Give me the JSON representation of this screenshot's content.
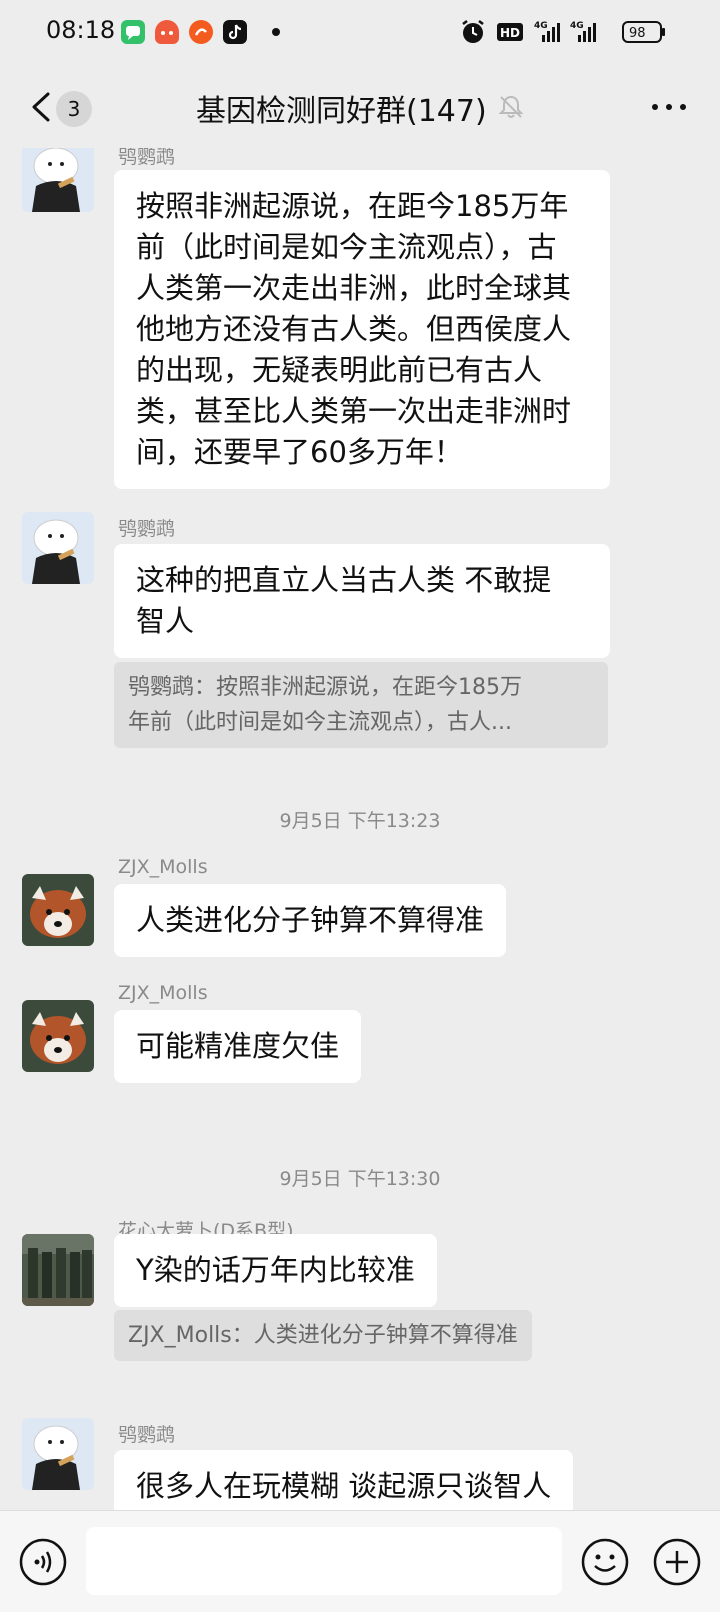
{
  "status_bar": {
    "time": "08:18",
    "hd_label": "HD",
    "net_label_1": "4G",
    "net_label_2": "4G",
    "battery": "98"
  },
  "header": {
    "back_badge": "3",
    "title": "基因检测同好群(147)"
  },
  "messages": [
    {
      "sender": "鸮鹦鹉",
      "lines": [
        "按照非洲起源说，在距今185万年",
        "前（此时间是如今主流观点），古",
        "人类第一次走出非洲，此时全球其",
        "他地方还没有古人类。但西侯度人",
        "的出现，无疑表明此前已有古人",
        "类，甚至比人类第一次出走非洲时",
        "间，还要早了60多万年！"
      ]
    },
    {
      "sender": "鸮鹦鹉",
      "lines": [
        "这种的把直立人当古人类  不敢提",
        "智人"
      ],
      "quote_lines": [
        "鸮鹦鹉：按照非洲起源说，在距今185万",
        "年前（此时间是如今主流观点），古人..."
      ]
    },
    {
      "sender": "ZJX_Molls",
      "lines": [
        "人类进化分子钟算不算得准"
      ]
    },
    {
      "sender": "ZJX_Molls",
      "lines": [
        "可能精准度欠佳"
      ]
    },
    {
      "sender": "花心大萝卜(D系B型)",
      "lines": [
        "Y染的话万年内比较准"
      ],
      "quote_lines": [
        "ZJX_Molls：人类进化分子钟算不算得准"
      ]
    },
    {
      "sender": "鸮鹦鹉",
      "lines": [
        "很多人在玩模糊 谈起源只谈智人"
      ]
    }
  ],
  "timestamps": [
    "9月5日 下午13:23",
    "9月5日 下午13:30"
  ],
  "colors": {
    "background": "#ededed",
    "bubble": "#ffffff",
    "quote_bg": "#dedede",
    "meta_text": "#8a8a8a"
  }
}
